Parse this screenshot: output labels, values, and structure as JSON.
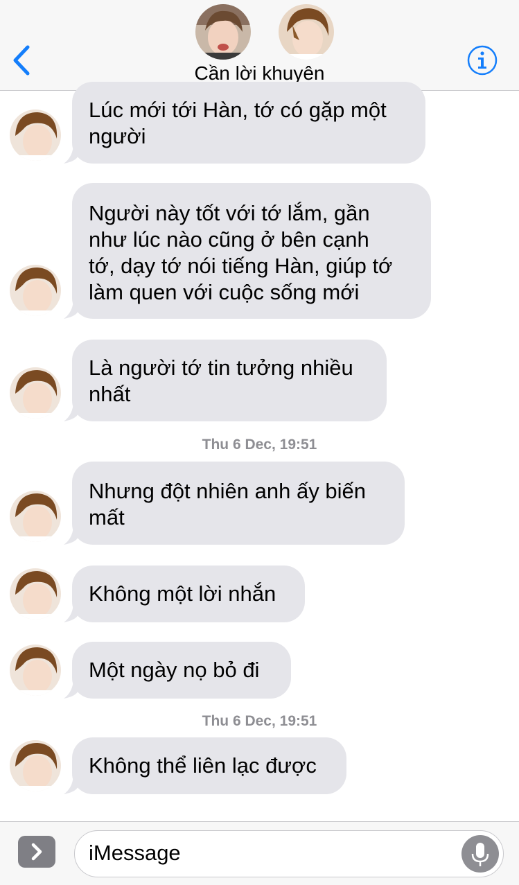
{
  "header": {
    "title": "Cần lời khuyên",
    "back_icon": "chevron-left-icon",
    "info_icon": "info-icon",
    "accent_color": "#147efb"
  },
  "messages": [
    {
      "text_lines": [
        "Lúc mới tới Hàn, tớ có gặp một",
        "người"
      ]
    },
    {
      "text_lines": [
        "Người này tốt với tớ lắm, gần",
        "như lúc nào cũng ở bên cạnh",
        "tớ, dạy tớ nói tiếng Hàn, giúp tớ",
        "làm quen với cuộc sống mới"
      ]
    },
    {
      "text_lines": [
        "Là người tớ tin tưởng nhiều",
        "nhất"
      ]
    },
    {
      "text_lines": [
        "Nhưng đột nhiên anh ấy biến",
        "mất"
      ]
    },
    {
      "text_lines": [
        "Không một lời nhắn"
      ]
    },
    {
      "text_lines": [
        "Một ngày nọ bỏ đi"
      ]
    },
    {
      "text_lines": [
        "Không thể liên lạc được"
      ]
    }
  ],
  "timestamps": [
    "Thu 6 Dec, 19:51",
    "Thu 6 Dec, 19:51"
  ],
  "input": {
    "placeholder": "iMessage",
    "apps_icon": "chevron-right-icon",
    "mic_icon": "microphone-icon"
  },
  "colors": {
    "bubble_received": "#e5e5ea",
    "timestamp": "#8e8e93"
  }
}
